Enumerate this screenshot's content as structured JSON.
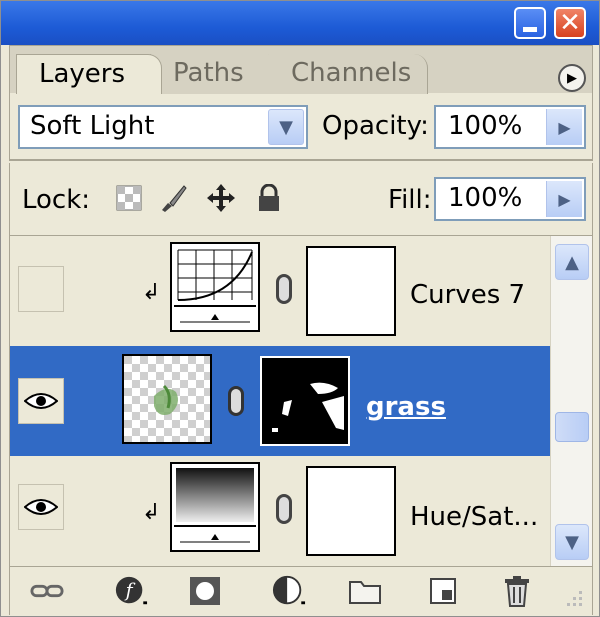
{
  "tabs": [
    {
      "label": "Layers",
      "active": true
    },
    {
      "label": "Paths",
      "active": false
    },
    {
      "label": "Channels",
      "active": false
    }
  ],
  "blend": {
    "mode": "Soft Light",
    "opacity_label": "Opacity:",
    "opacity_value": "100%"
  },
  "lock": {
    "label": "Lock:",
    "fill_label": "Fill:",
    "fill_value": "100%"
  },
  "layers": [
    {
      "name": "Curves 7",
      "visible": false,
      "clipped": true,
      "selected": false
    },
    {
      "name": "grass",
      "visible": true,
      "clipped": false,
      "selected": true
    },
    {
      "name": "Hue/Sat...",
      "visible": true,
      "clipped": true,
      "selected": false
    }
  ],
  "colors": {
    "selection": "#316ac5",
    "panel": "#ece9d8",
    "titlebar": "#1d5bd6"
  },
  "icons": {
    "window": [
      "minimize-icon",
      "close-icon"
    ],
    "lock": [
      "lock-transparency-icon",
      "lock-image-icon",
      "lock-position-icon",
      "lock-all-icon"
    ],
    "bottom": [
      "link-icon",
      "layer-style-icon",
      "mask-icon",
      "adjustment-layer-icon",
      "group-folder-icon",
      "new-layer-icon",
      "trash-icon",
      "resize-grip-icon"
    ]
  }
}
